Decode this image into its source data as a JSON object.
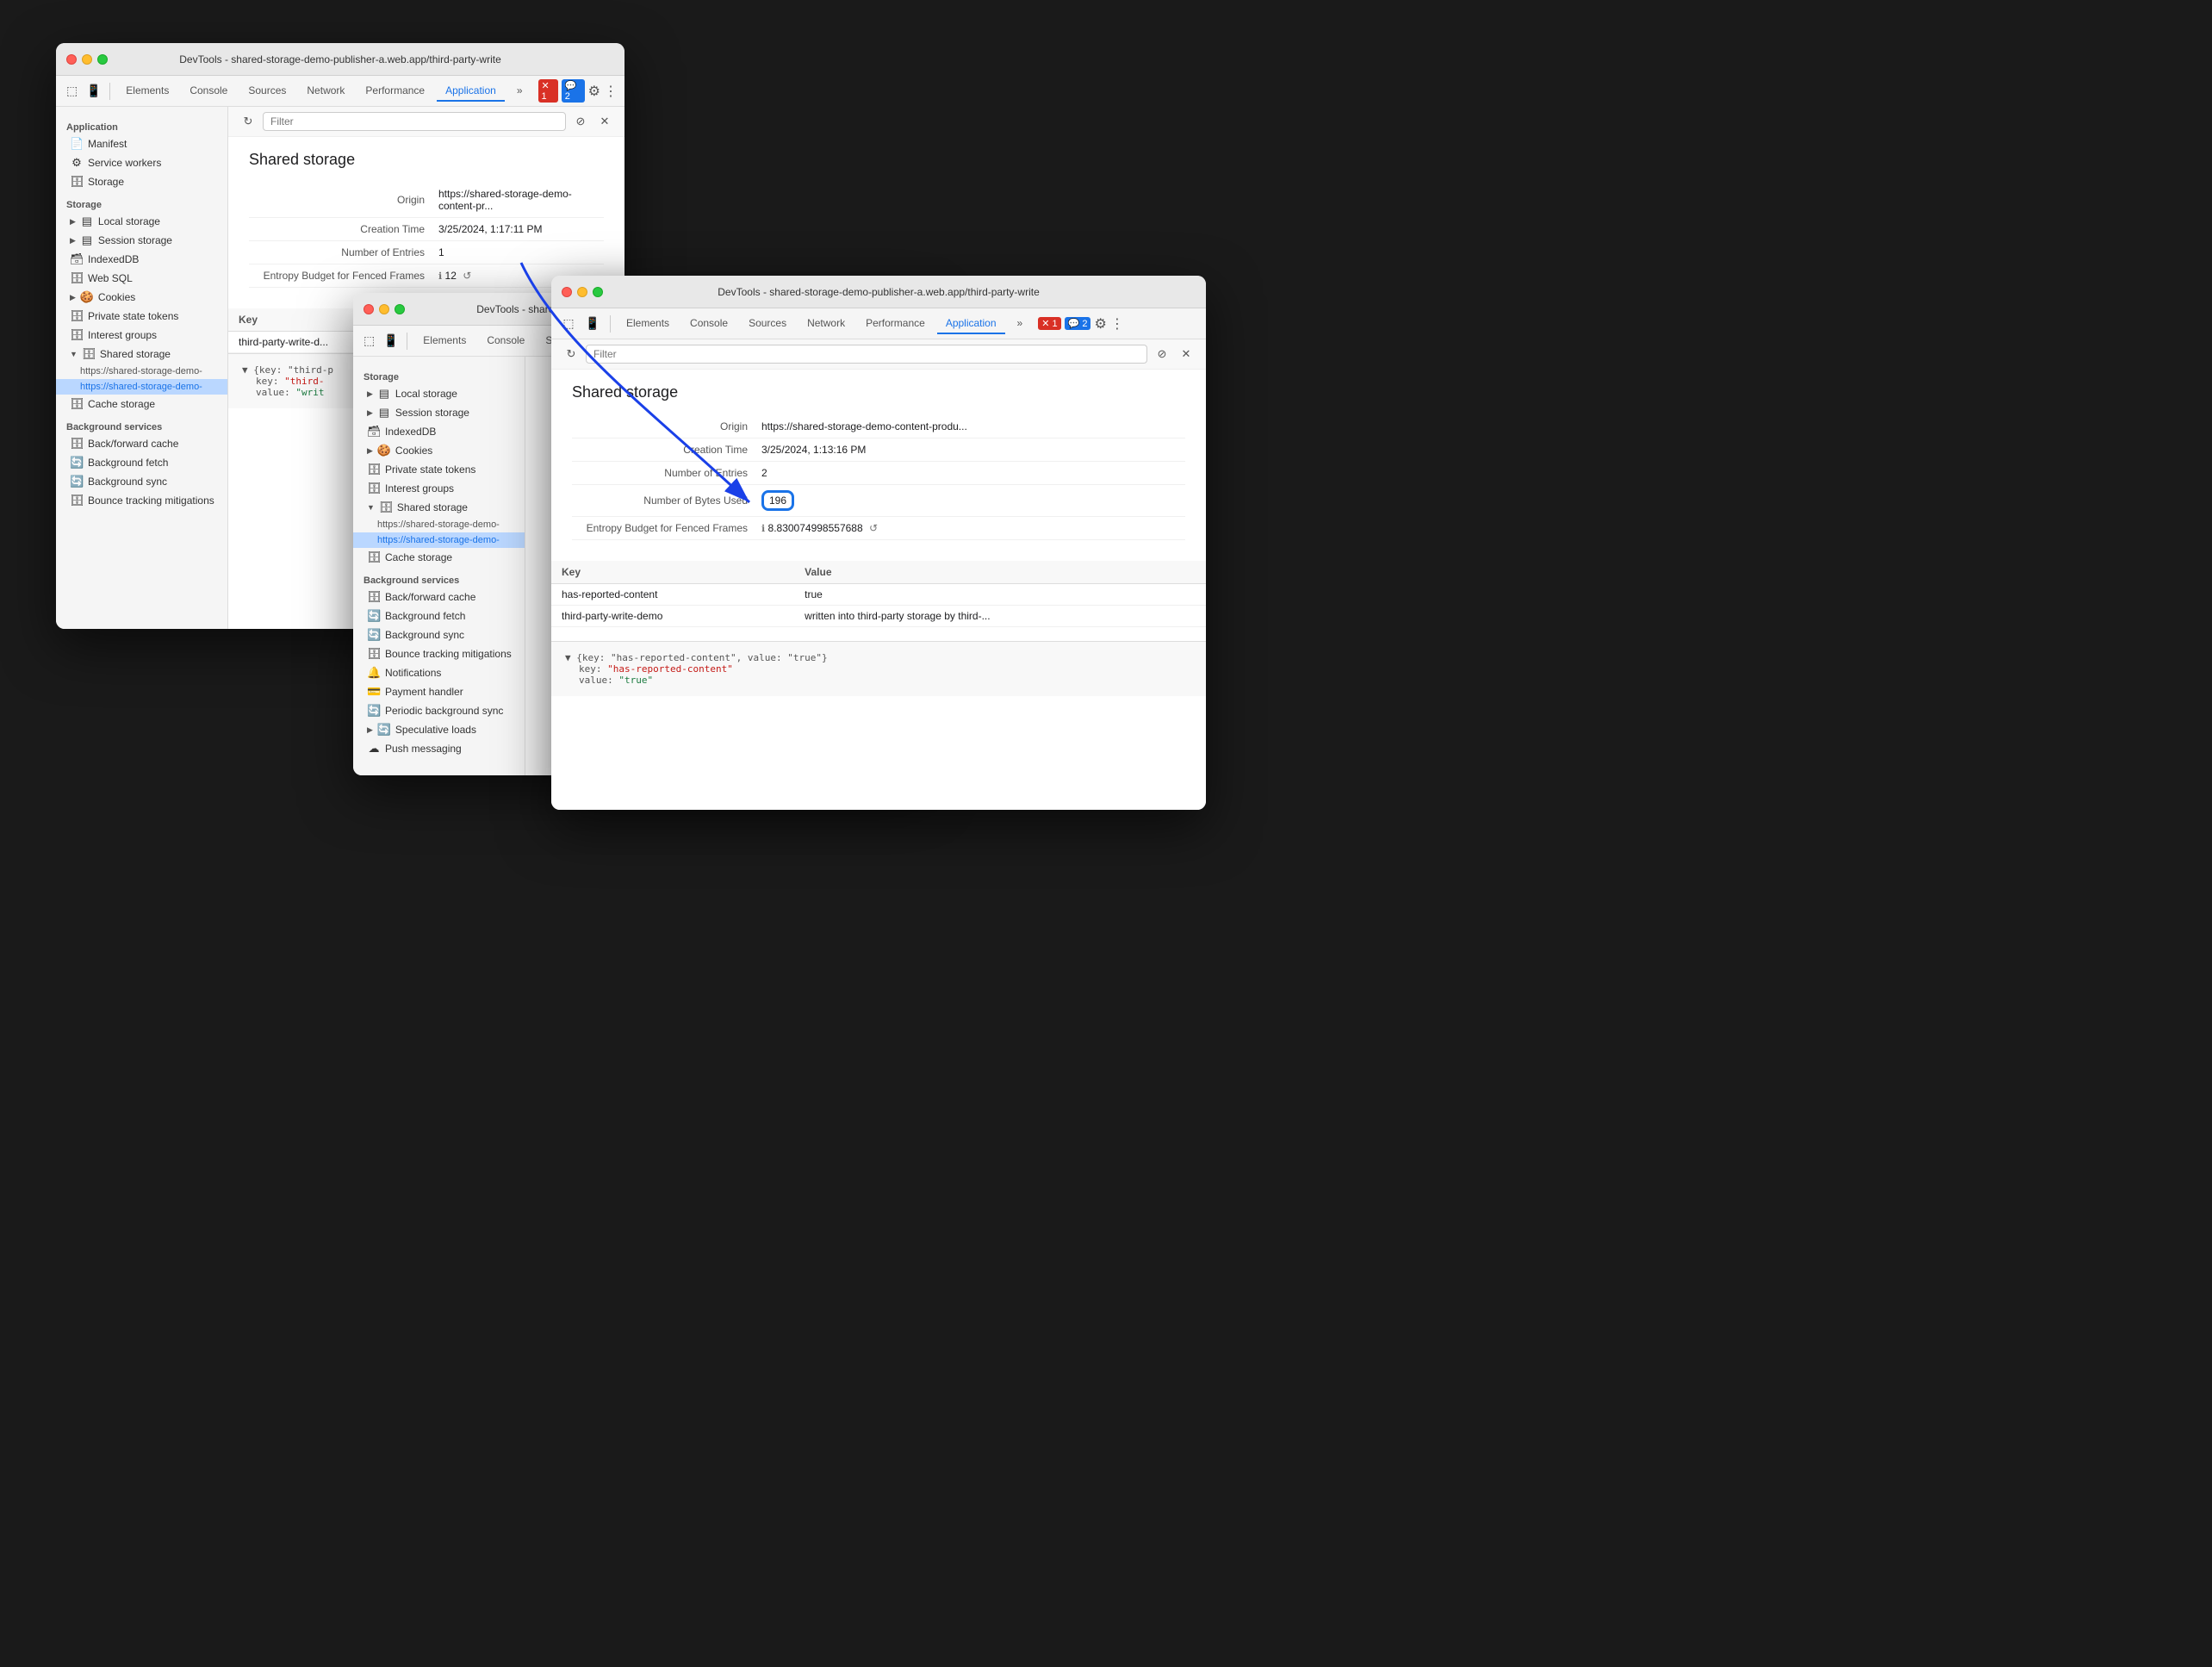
{
  "window1": {
    "title": "DevTools - shared-storage-demo-publisher-a.web.app/third-party-write",
    "tabs": [
      "Elements",
      "Console",
      "Sources",
      "Network",
      "Performance",
      "Application"
    ],
    "activeTab": "Application",
    "filter": {
      "placeholder": "Filter"
    },
    "sidebar": {
      "sections": [
        {
          "label": "Application",
          "items": [
            {
              "icon": "📄",
              "label": "Manifest",
              "indent": 1
            },
            {
              "icon": "⚙️",
              "label": "Service workers",
              "indent": 1
            },
            {
              "icon": "🗄️",
              "label": "Storage",
              "indent": 1
            }
          ]
        },
        {
          "label": "Storage",
          "items": [
            {
              "icon": "▶",
              "label": "Local storage",
              "indent": 1,
              "expandable": true
            },
            {
              "icon": "▶",
              "label": "Session storage",
              "indent": 1,
              "expandable": true
            },
            {
              "icon": "",
              "label": "IndexedDB",
              "indent": 1
            },
            {
              "icon": "",
              "label": "Web SQL",
              "indent": 1
            },
            {
              "icon": "▶",
              "label": "Cookies",
              "indent": 1,
              "expandable": true
            },
            {
              "icon": "",
              "label": "Private state tokens",
              "indent": 1
            },
            {
              "icon": "",
              "label": "Interest groups",
              "indent": 1
            },
            {
              "icon": "▼",
              "label": "Shared storage",
              "indent": 1,
              "expanded": true
            },
            {
              "icon": "",
              "label": "https://shared-storage-demo-",
              "indent": 2
            },
            {
              "icon": "",
              "label": "https://shared-storage-demo-",
              "indent": 2,
              "active": true
            },
            {
              "icon": "",
              "label": "Cache storage",
              "indent": 1
            }
          ]
        },
        {
          "label": "Background services",
          "items": [
            {
              "icon": "",
              "label": "Back/forward cache",
              "indent": 1
            },
            {
              "icon": "",
              "label": "Background fetch",
              "indent": 1
            },
            {
              "icon": "",
              "label": "Background sync",
              "indent": 1
            },
            {
              "icon": "",
              "label": "Bounce tracking mitigations",
              "indent": 1
            }
          ]
        }
      ]
    },
    "content": {
      "title": "Shared storage",
      "origin": {
        "label": "Origin",
        "value": "https://shared-storage-demo-content-pr..."
      },
      "creationTime": {
        "label": "Creation Time",
        "value": "3/25/2024, 1:17:11 PM"
      },
      "numberOfEntries": {
        "label": "Number of Entries",
        "value": "1"
      },
      "entropyBudget": {
        "label": "Entropy Budget for Fenced Frames",
        "value": "12"
      }
    },
    "table": {
      "headers": [
        "Key",
        "Value"
      ],
      "rows": [
        {
          "key": "third-party-write-d...",
          "value": ""
        }
      ]
    },
    "jsonPreview": {
      "line1": "{key: \"third-p",
      "keyLine": "key: \"third-",
      "valueLine": "value: \"writ"
    }
  },
  "window2": {
    "title": "DevTools - shared-storage-demo-publisher-a.web.app/third-party-write",
    "tabs": [
      "Elements",
      "Console",
      "Sources",
      "Network",
      "Performance",
      "Application"
    ],
    "activeTab": "Application",
    "badges": {
      "errors": "1",
      "info": "2"
    },
    "sidebar": {
      "sections": [
        {
          "label": "Storage",
          "items": [
            {
              "icon": "▶",
              "label": "Local storage",
              "indent": 1,
              "expandable": true
            },
            {
              "icon": "▶",
              "label": "Session storage",
              "indent": 1,
              "expandable": true
            },
            {
              "icon": "",
              "label": "IndexedDB",
              "indent": 1
            },
            {
              "icon": "▶",
              "label": "Cookies",
              "indent": 1,
              "expandable": true
            },
            {
              "icon": "",
              "label": "Private state tokens",
              "indent": 1
            },
            {
              "icon": "",
              "label": "Interest groups",
              "indent": 1
            },
            {
              "icon": "▼",
              "label": "Shared storage",
              "indent": 1,
              "expanded": true
            },
            {
              "icon": "",
              "label": "https://shared-storage-demo-",
              "indent": 2
            },
            {
              "icon": "",
              "label": "https://shared-storage-demo-",
              "indent": 2,
              "active": true
            },
            {
              "icon": "",
              "label": "Cache storage",
              "indent": 1
            }
          ]
        },
        {
          "label": "Background services",
          "items": [
            {
              "icon": "",
              "label": "Back/forward cache",
              "indent": 1
            },
            {
              "icon": "",
              "label": "Background fetch",
              "indent": 1
            },
            {
              "icon": "",
              "label": "Background sync",
              "indent": 1
            },
            {
              "icon": "",
              "label": "Bounce tracking mitigations",
              "indent": 1
            },
            {
              "icon": "",
              "label": "Notifications",
              "indent": 1
            },
            {
              "icon": "",
              "label": "Payment handler",
              "indent": 1
            },
            {
              "icon": "",
              "label": "Periodic background sync",
              "indent": 1
            },
            {
              "icon": "▶",
              "label": "Speculative loads",
              "indent": 1
            },
            {
              "icon": "",
              "label": "Push messaging",
              "indent": 1
            }
          ]
        }
      ]
    }
  },
  "window3": {
    "title": "DevTools - shared-storage-demo-publisher-a.web.app/third-party-write",
    "tabs": [
      "Elements",
      "Console",
      "Sources",
      "Network",
      "Performance",
      "Application"
    ],
    "activeTab": "Application",
    "badges": {
      "errors": "1",
      "info": "2"
    },
    "content": {
      "title": "Shared storage",
      "origin": {
        "label": "Origin",
        "value": "https://shared-storage-demo-content-produ..."
      },
      "creationTime": {
        "label": "Creation Time",
        "value": "3/25/2024, 1:13:16 PM"
      },
      "numberOfEntries": {
        "label": "Number of Entries",
        "value": "2"
      },
      "numberOfBytesUsed": {
        "label": "Number of Bytes Used",
        "value": "196"
      },
      "entropyBudget": {
        "label": "Entropy Budget for Fenced Frames",
        "value": "8.830074998557688",
        "icon": "ℹ"
      }
    },
    "table": {
      "headers": [
        "Key",
        "Value"
      ],
      "rows": [
        {
          "key": "has-reported-content",
          "value": "true"
        },
        {
          "key": "third-party-write-demo",
          "value": "written into third-party storage by third-..."
        }
      ]
    },
    "jsonPreview": {
      "bracketOpen": "▼ {key: \"has-reported-content\", value: \"true\"}",
      "keyLabel": "key:",
      "keyValue": "\"has-reported-content\"",
      "valueLabel": "value:",
      "valueValue": "\"true\""
    }
  },
  "icons": {
    "manifest": "📄",
    "serviceWorkers": "⚙",
    "storage": "🗄",
    "localStorage": "▤",
    "sessionStorage": "▤",
    "indexedDB": "🗃",
    "cookies": "🍪",
    "sharedStorage": "🗄",
    "cacheStorage": "🗄",
    "backgroundService": "🔄",
    "notifications": "🔔",
    "reload": "↺",
    "clear": "⊘",
    "close": "✕",
    "info": "ℹ",
    "reset": "↺"
  }
}
